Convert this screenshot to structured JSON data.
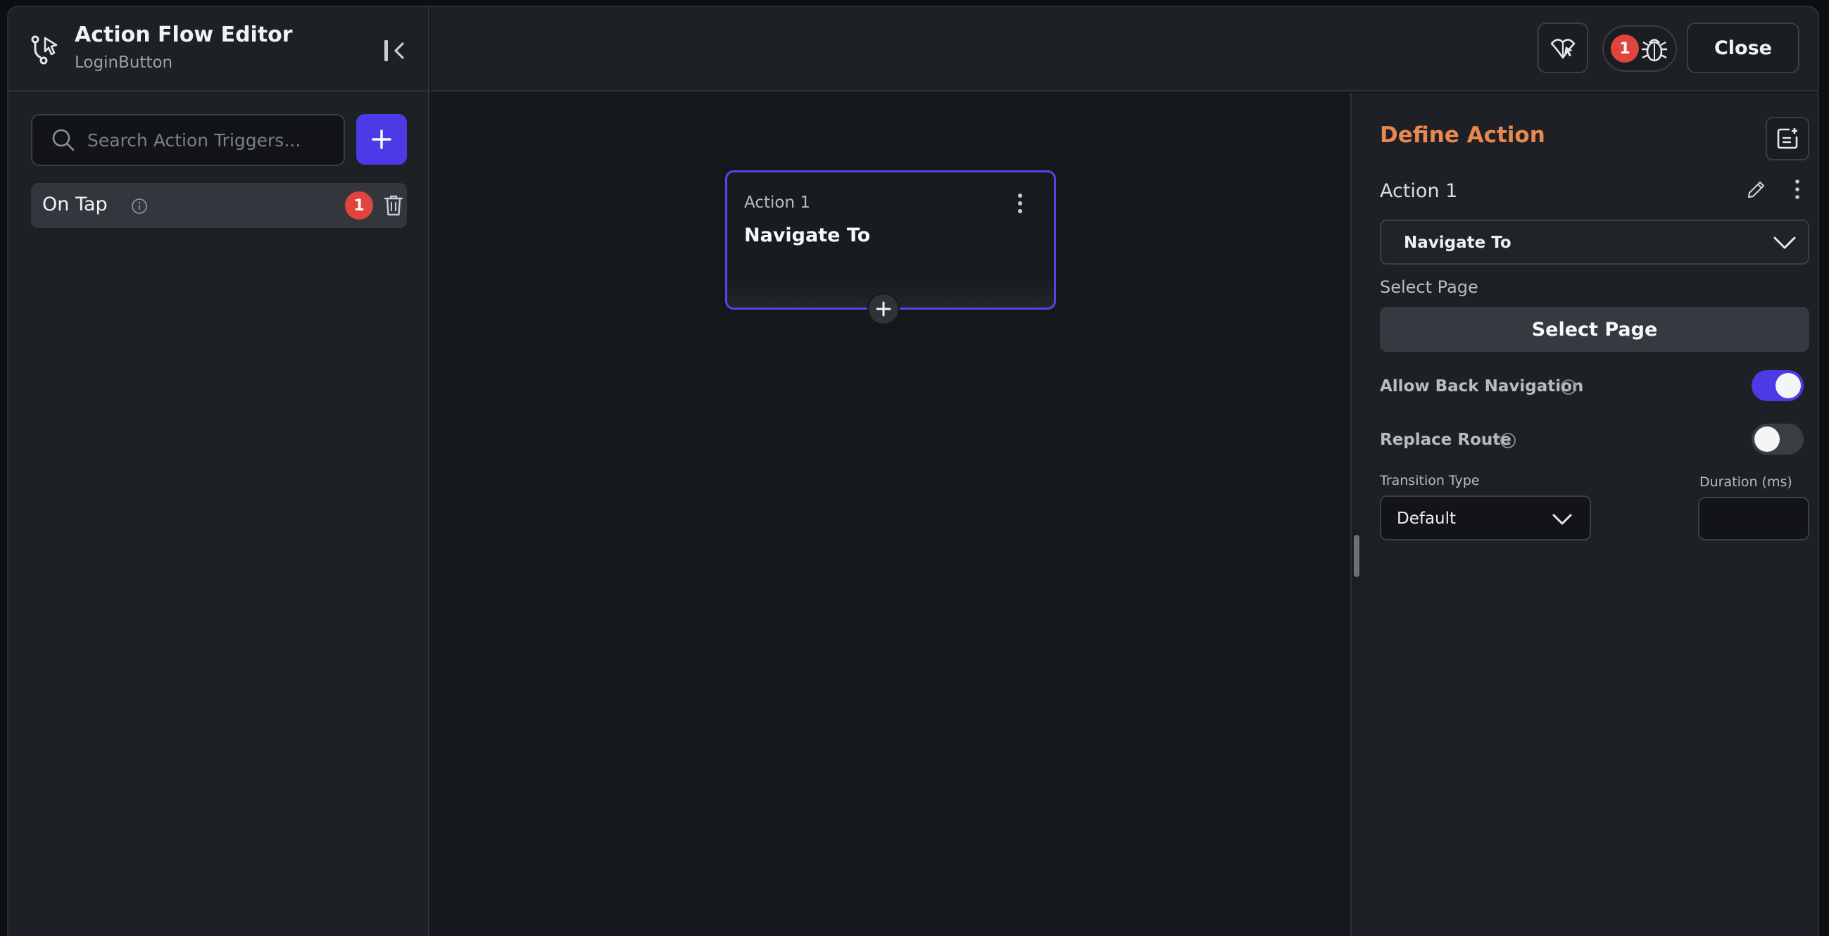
{
  "header": {
    "title": "Action Flow Editor",
    "subtitle": "LoginButton",
    "close_label": "Close",
    "debug_count": "1"
  },
  "sidebar": {
    "search_placeholder": "Search Action Triggers...",
    "triggers": [
      {
        "label": "On Tap",
        "badge": "1"
      }
    ]
  },
  "canvas": {
    "card": {
      "label": "Action 1",
      "title": "Navigate To"
    }
  },
  "panel": {
    "title": "Define Action",
    "action_name": "Action 1",
    "action_type": "Navigate To",
    "select_page_label": "Select Page",
    "select_page_button": "Select Page",
    "allow_back_label": "Allow Back Navigation",
    "allow_back_on": true,
    "replace_route_label": "Replace Route",
    "replace_route_on": false,
    "transition_label": "Transition Type",
    "transition_value": "Default",
    "duration_label": "Duration (ms)",
    "duration_value": ""
  },
  "colors": {
    "accent": "#4b3ae6",
    "heading": "#e8884f",
    "badge": "#e0443d"
  },
  "icons": {
    "app": "flow-icon",
    "collapse": "collapse-sidebar-icon",
    "search": "search-icon",
    "add": "plus-icon",
    "info": "info-icon",
    "delete": "trash-icon",
    "ai": "ai-agent-icon",
    "debug": "bug-icon",
    "notes": "notes-icon",
    "edit": "pencil-icon",
    "more": "more-vertical-icon",
    "dropdown": "chevron-down-icon"
  }
}
